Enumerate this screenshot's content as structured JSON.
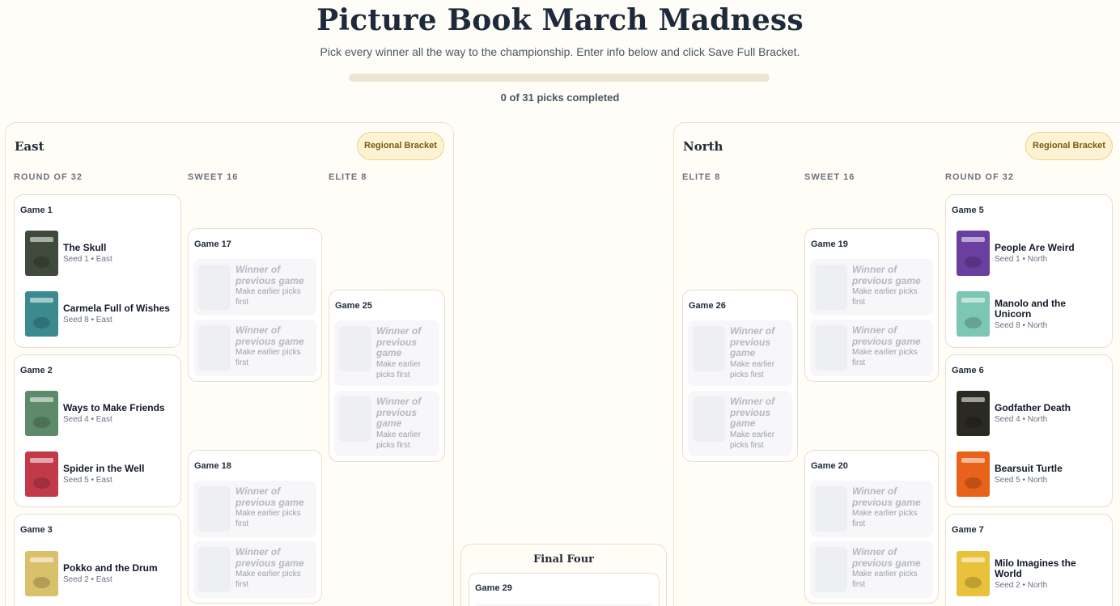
{
  "header": {
    "title": "Picture Book March Madness",
    "subtitle": "Pick every winner all the way to the championship. Enter info below and click Save Full Bracket.",
    "progress_text": "0 of 31 picks completed",
    "progress_fraction": 0
  },
  "placeholder": {
    "title": "Winner of previous game",
    "subtitle": "Make earlier picks first"
  },
  "east": {
    "name": "East",
    "badge": "Regional Bracket",
    "rounds": [
      "ROUND OF 32",
      "SWEET 16",
      "ELITE 8"
    ],
    "games": [
      {
        "title": "Game 1",
        "entries": [
          {
            "name": "The Skull",
            "seed": "Seed 1 • East",
            "cover_color": "#3f4a3c"
          },
          {
            "name": "Carmela Full of Wishes",
            "seed": "Seed 8 • East",
            "cover_color": "#3a8a8e"
          }
        ]
      },
      {
        "title": "Game 2",
        "entries": [
          {
            "name": "Ways to Make Friends",
            "seed": "Seed 4 • East",
            "cover_color": "#5d8a6a"
          },
          {
            "name": "Spider in the Well",
            "seed": "Seed 5 • East",
            "cover_color": "#c23a4a"
          }
        ]
      },
      {
        "title": "Game 3",
        "entries": [
          {
            "name": "Pokko and the Drum",
            "seed": "Seed 2 • East",
            "cover_color": "#d9c06a"
          }
        ]
      }
    ],
    "later_games": [
      "Game 17",
      "Game 18",
      "Game 25"
    ]
  },
  "north": {
    "name": "North",
    "badge": "Regional Bracket",
    "rounds": [
      "ELITE 8",
      "SWEET 16",
      "ROUND OF 32"
    ],
    "games": [
      {
        "title": "Game 5",
        "entries": [
          {
            "name": "People Are Weird",
            "seed": "Seed 1 • North",
            "cover_color": "#6b3fa0"
          },
          {
            "name": "Manolo and the Unicorn",
            "seed": "Seed 8 • North",
            "cover_color": "#7cc6b4"
          }
        ]
      },
      {
        "title": "Game 6",
        "entries": [
          {
            "name": "Godfather Death",
            "seed": "Seed 4 • North",
            "cover_color": "#2a2a22"
          },
          {
            "name": "Bearsuit Turtle",
            "seed": "Seed 5 • North",
            "cover_color": "#e8621c"
          }
        ]
      },
      {
        "title": "Game 7",
        "entries": [
          {
            "name": "Milo Imagines the World",
            "seed": "Seed 2 • North",
            "cover_color": "#e9c23c"
          }
        ]
      }
    ],
    "later_games": [
      "Game 26",
      "Game 19",
      "Game 20"
    ]
  },
  "final_four": {
    "title": "Final Four",
    "game": "Game 29"
  }
}
